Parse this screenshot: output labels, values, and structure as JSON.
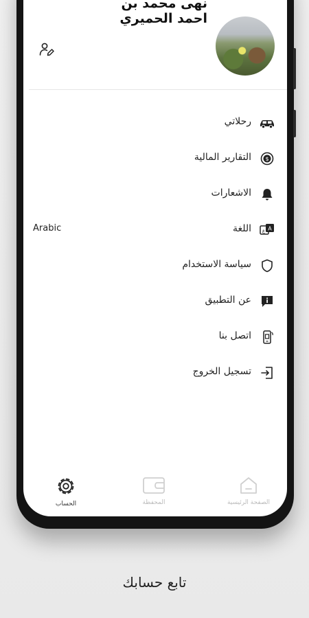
{
  "user": {
    "name": "نهى محمد بن احمد الحميري"
  },
  "menu": [
    {
      "label": "رحلاتي",
      "icon": "car-icon"
    },
    {
      "label": "التقارير المالية",
      "icon": "coin-icon"
    },
    {
      "label": "الاشعارات",
      "icon": "bell-icon"
    },
    {
      "label": "اللغة",
      "icon": "translate-icon",
      "value": "Arabic"
    },
    {
      "label": "سياسة الاستخدام",
      "icon": "shield-icon"
    },
    {
      "label": "عن التطبيق",
      "icon": "info-icon"
    },
    {
      "label": "اتصل بنا",
      "icon": "phone-icon"
    },
    {
      "label": "تسجيل الخروج",
      "icon": "logout-icon"
    }
  ],
  "nav": {
    "home": {
      "label": "الصفحة الرئيسية",
      "icon": "home-icon"
    },
    "wallet": {
      "label": "المحفظة",
      "icon": "wallet-icon"
    },
    "account": {
      "label": "الحساب",
      "icon": "gear-icon",
      "active": true
    }
  },
  "caption": "تابع حسابك"
}
